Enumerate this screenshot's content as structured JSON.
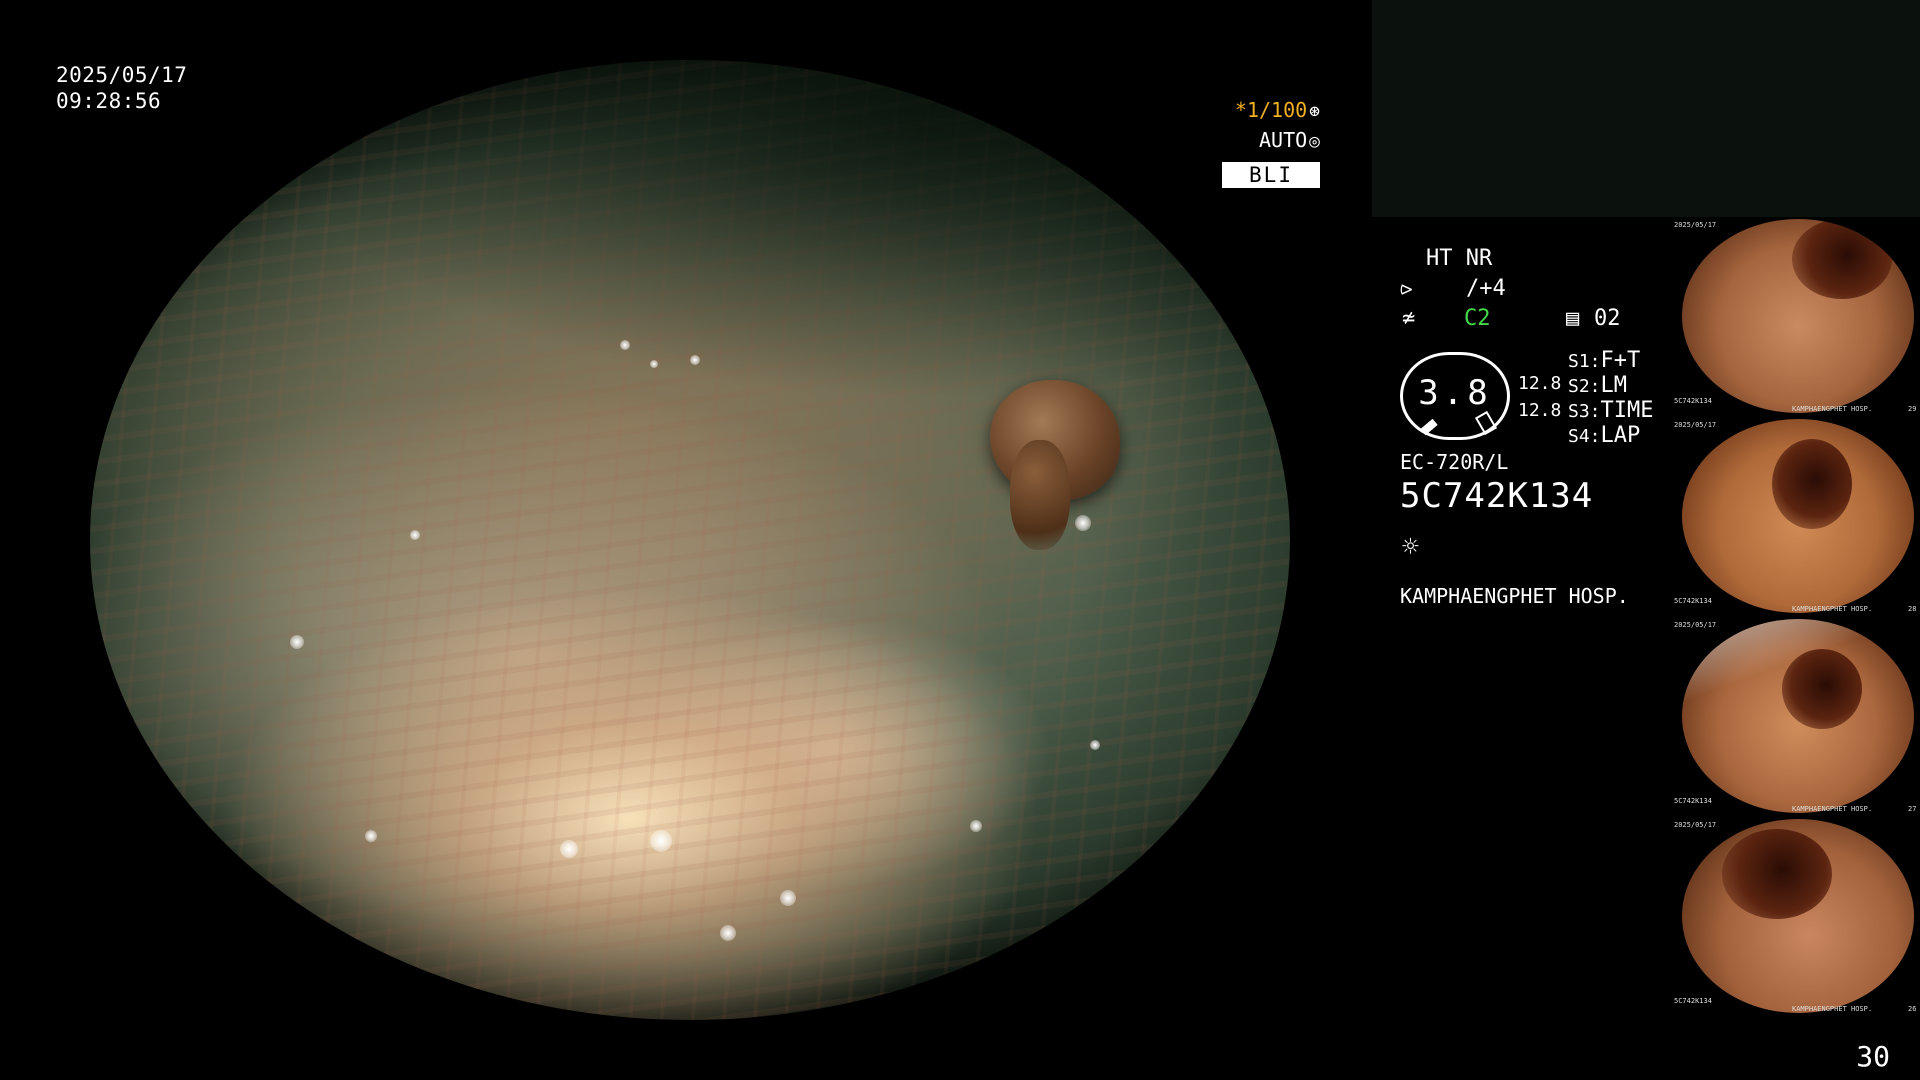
{
  "header": {
    "date": "2025/05/17",
    "time": "09:28:56"
  },
  "indicators": {
    "shutter": "*1/100",
    "shutter_icon": "aperture-icon",
    "auto": "AUTO",
    "auto_icon": "iris-icon",
    "mode": "BLI"
  },
  "info": {
    "ht_nr": "HT NR",
    "enhance_value": "/+4",
    "enhance_icon": "enhance-icon",
    "color_value": "C2",
    "color_icon": "color-tone-icon",
    "memory_icon": "memory-card-icon",
    "memory_value": "02",
    "gauge_value": "3.8",
    "gauge_top": "12.8",
    "gauge_bottom": "12.8",
    "switches": [
      {
        "key": "S1:",
        "value": "F+T"
      },
      {
        "key": "S2:",
        "value": "LM"
      },
      {
        "key": "S3:",
        "value": "TIME"
      },
      {
        "key": "S4:",
        "value": "LAP"
      }
    ],
    "scope_model": "EC-720R/L",
    "scope_serial": "5C742K134",
    "light_icon": "light-icon",
    "hospital": "KAMPHAENGPHET HOSP."
  },
  "thumbnails": [
    {
      "caption_top": "2025/05/17",
      "caption_serial": "5C742K134",
      "caption_hosp": "KAMPHAENGPHET HOSP.",
      "number": "29"
    },
    {
      "caption_top": "2025/05/17",
      "caption_serial": "5C742K134",
      "caption_hosp": "KAMPHAENGPHET HOSP.",
      "number": "28"
    },
    {
      "caption_top": "2025/05/17",
      "caption_serial": "5C742K134",
      "caption_hosp": "KAMPHAENGPHET HOSP.",
      "number": "27"
    },
    {
      "caption_top": "2025/05/17",
      "caption_serial": "5C742K134",
      "caption_hosp": "KAMPHAENGPHET HOSP.",
      "number": "26"
    }
  ],
  "page_number": "30",
  "colors": {
    "shutter": "#f0b020",
    "color_mode": "#43d949",
    "panel": "#0b110d"
  }
}
